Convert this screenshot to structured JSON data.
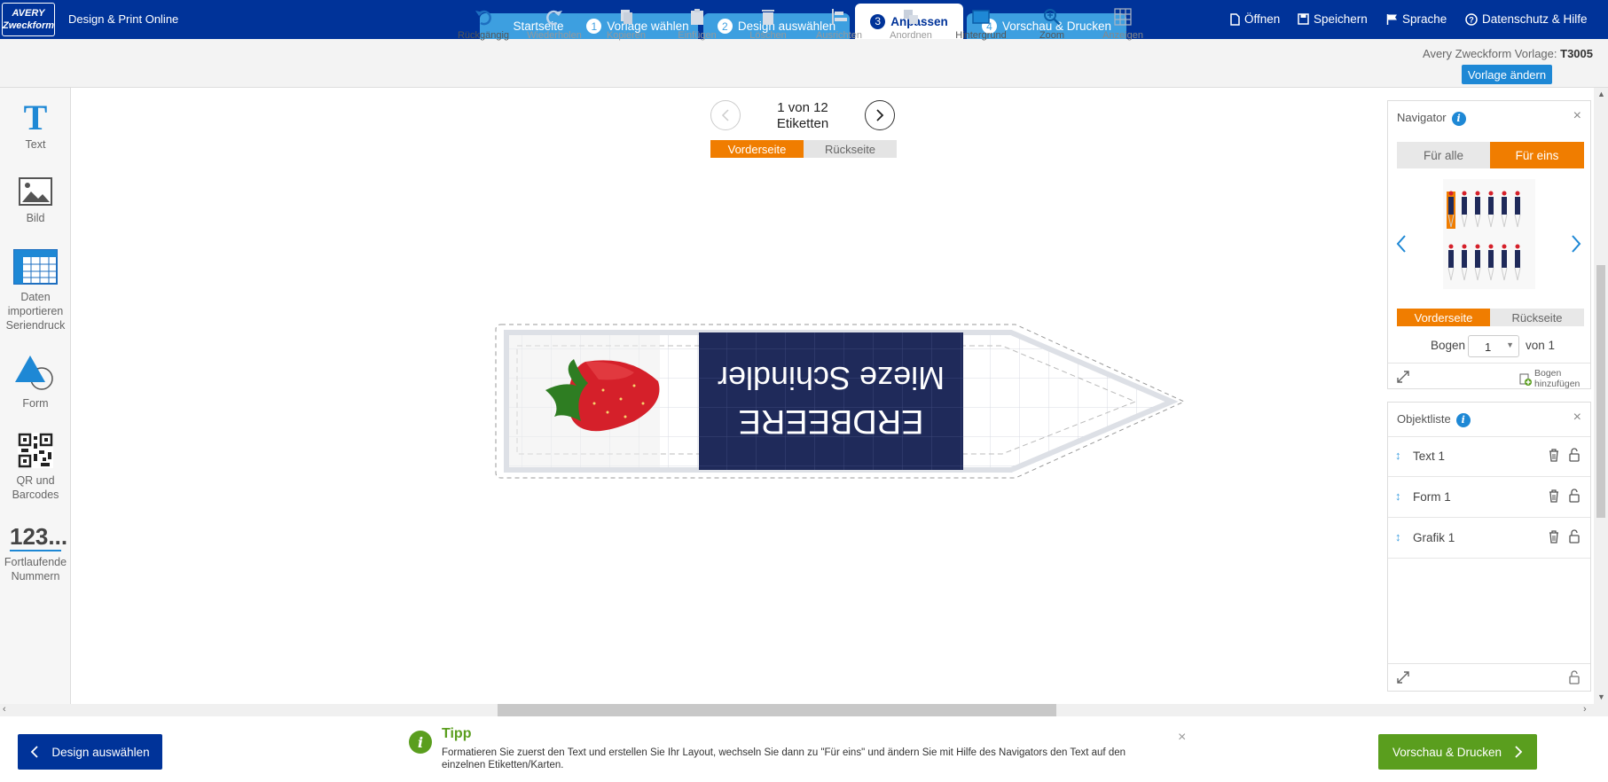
{
  "header": {
    "logo_line1": "AVERY",
    "logo_line2": "Zweckform",
    "app_title": "Design & Print Online",
    "tabs": [
      {
        "label": "Startseite",
        "num": ""
      },
      {
        "label": "Vorlage wählen",
        "num": "1"
      },
      {
        "label": "Design auswählen",
        "num": "2"
      },
      {
        "label": "Anpassen",
        "num": "3"
      },
      {
        "label": "Vorschau & Drucken",
        "num": "4"
      }
    ],
    "menu": {
      "open": "Öffnen",
      "save": "Speichern",
      "language": "Sprache",
      "help": "Datenschutz & Hilfe"
    }
  },
  "toolbar": {
    "items": [
      "Rückgängig",
      "Wiederholen",
      "Kopieren",
      "Einfügen",
      "Löschen",
      "Ausrichten",
      "Anordnen",
      "Hintergrund",
      "Zoom",
      "Anzeigen"
    ],
    "template_label": "Avery Zweckform Vorlage:",
    "template_code": "T3005",
    "change_template": "Vorlage ändern"
  },
  "left_panel": {
    "text": "Text",
    "image": "Bild",
    "data_line1": "Daten",
    "data_line2": "importieren",
    "data_line3": "Seriendruck",
    "shape": "Form",
    "qr_line1": "QR und",
    "qr_line2": "Barcodes",
    "number_icon": "123...",
    "number_line1": "Fortlaufende",
    "number_line2": "Nummern"
  },
  "canvas": {
    "pager_line1": "1 von 12",
    "pager_line2": "Etiketten",
    "front": "Vorderseite",
    "back": "Rückseite",
    "label_name": "Mieze Schindler",
    "label_fruit": "ERDBEERE"
  },
  "navigator": {
    "title": "Navigator",
    "for_all": "Für alle",
    "for_one": "Für eins",
    "front": "Vorderseite",
    "back": "Rückseite",
    "sheet_label": "Bogen",
    "sheet_value": "1",
    "sheet_of": "von 1",
    "add_sheet_line1": "Bogen",
    "add_sheet_line2": "hinzufügen"
  },
  "objects": {
    "title": "Objektliste",
    "items": [
      "Text 1",
      "Form 1",
      "Grafik 1"
    ]
  },
  "footer": {
    "back_button": "Design auswählen",
    "next_button": "Vorschau & Drucken",
    "tip_title": "Tipp",
    "tip_text": "Formatieren Sie zuerst den Text und erstellen Sie Ihr Layout, wechseln Sie dann zu \"Für eins\" und ändern Sie mit Hilfe des Navigators den Text auf den einzelnen Etiketten/Karten."
  },
  "colors": {
    "header": "#003399",
    "tab": "#3d9fe0",
    "accent_orange": "#f07d00",
    "green": "#5a9e1e",
    "label_bg": "#1f2a5a"
  }
}
